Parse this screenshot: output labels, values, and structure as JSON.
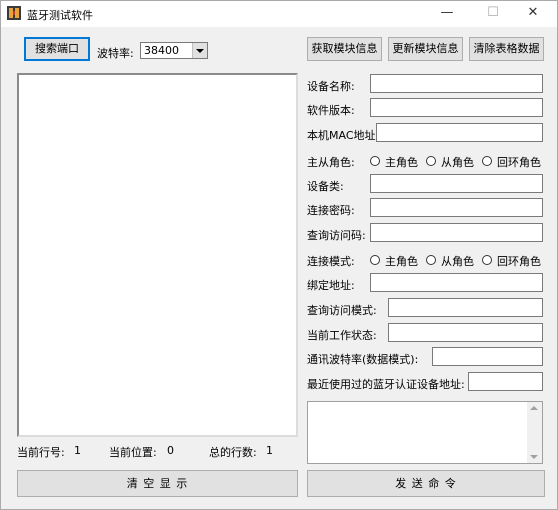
{
  "window": {
    "title": "蓝牙测试软件",
    "minimize_symbol": "—",
    "maximize_symbol": "☐",
    "close_symbol": "✕"
  },
  "toolbar": {
    "search_port_label": "搜索端口",
    "baud_label": "波特率:",
    "baud_value": "38400",
    "get_info_label": "获取模块信息",
    "update_info_label": "更新模块信息",
    "clear_table_label": "清除表格数据"
  },
  "fields": {
    "device_name": "设备名称:",
    "software_version": "软件版本:",
    "local_mac": "本机MAC地址:",
    "role_label": "主从角色:",
    "device_class": "设备类:",
    "pin_code": "连接密码:",
    "inquiry_code": "查询访问码:",
    "connect_mode_label": "连接模式:",
    "bind_address": "绑定地址:",
    "inquiry_mode": "查询访问模式:",
    "work_state": "当前工作状态:",
    "comm_baud": "通讯波特率(数据模式):",
    "recent_address": "最近使用过的蓝牙认证设备地址:"
  },
  "radios": {
    "master": "主角色",
    "slave": "从角色",
    "loopback": "回环角色"
  },
  "status": {
    "current_line_label": "当前行号:",
    "current_line_value": "1",
    "current_pos_label": "当前位置:",
    "current_pos_value": "0",
    "total_lines_label": "总的行数:",
    "total_lines_value": "1"
  },
  "actions": {
    "clear_display_label": "清 空 显 示",
    "send_command_label": "发 送 命 令"
  },
  "icons": {
    "app": "app-film-icon",
    "combo_arrow": "chevron-down-icon"
  }
}
